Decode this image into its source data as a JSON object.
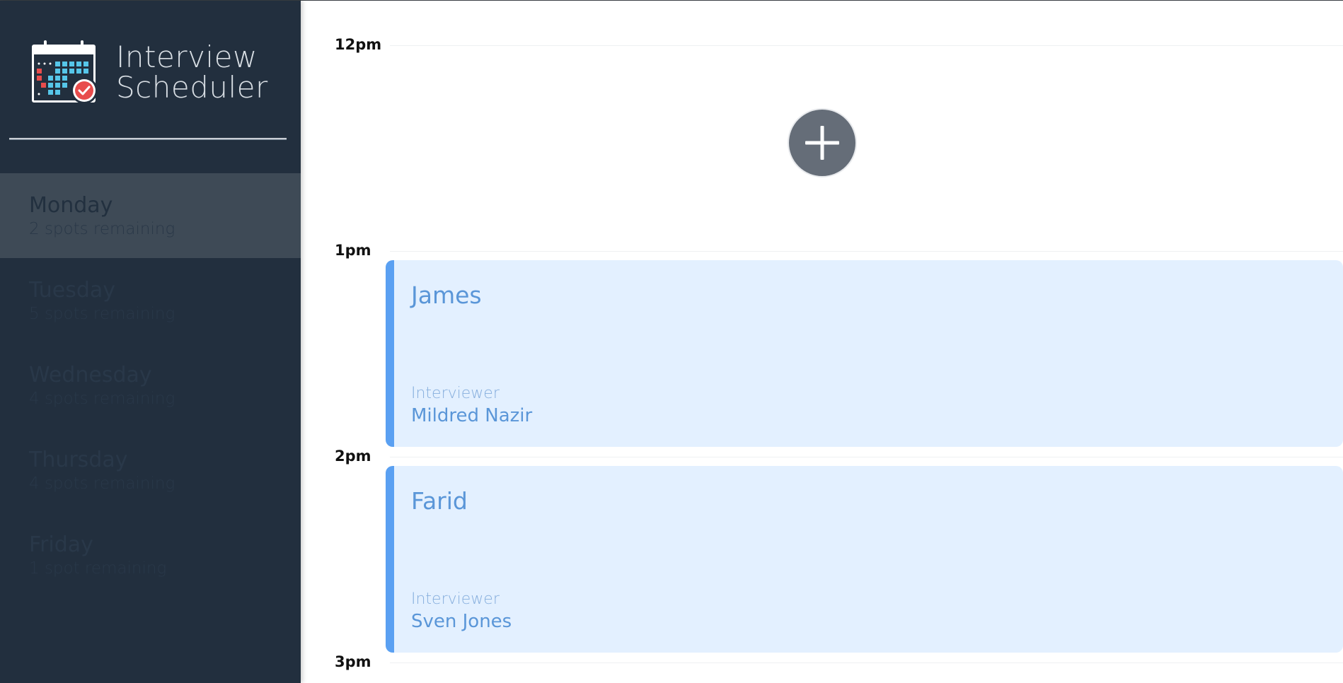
{
  "brand": {
    "title_line1": "Interview",
    "title_line2": "Scheduler"
  },
  "days": [
    {
      "name": "Monday",
      "spots": "2 spots remaining",
      "selected": true
    },
    {
      "name": "Tuesday",
      "spots": "5 spots remaining",
      "selected": false
    },
    {
      "name": "Wednesday",
      "spots": "4 spots remaining",
      "selected": false
    },
    {
      "name": "Thursday",
      "spots": "4 spots remaining",
      "selected": false
    },
    {
      "name": "Friday",
      "spots": "1 spot remaining",
      "selected": false
    }
  ],
  "schedule": {
    "slots": [
      {
        "time": "12pm",
        "type": "empty",
        "icon": "plus-icon"
      },
      {
        "time": "1pm",
        "type": "appointment",
        "student": "James",
        "interviewer_label": "Interviewer",
        "interviewer": "Mildred Nazir"
      },
      {
        "time": "2pm",
        "type": "appointment",
        "student": "Farid",
        "interviewer_label": "Interviewer",
        "interviewer": "Sven Jones"
      },
      {
        "time": "3pm",
        "type": "end"
      }
    ]
  },
  "colors": {
    "sidebar_bg": "#222f3e",
    "selected_bg": "#3e4a56",
    "appointment_bg": "#e3f0ff",
    "appointment_accent": "#5aa0f2",
    "add_button": "#656d78"
  }
}
